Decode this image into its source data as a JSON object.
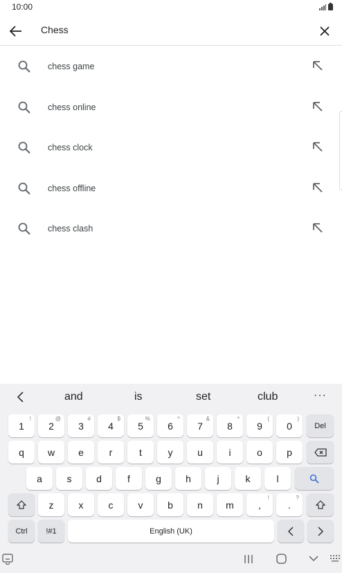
{
  "status_bar": {
    "time": "10:00"
  },
  "search": {
    "query": "Chess"
  },
  "suggestions": [
    {
      "text": "chess game"
    },
    {
      "text": "chess online"
    },
    {
      "text": "chess clock"
    },
    {
      "text": "chess offline"
    },
    {
      "text": "chess clash"
    }
  ],
  "keyboard": {
    "predictions": [
      "and",
      "is",
      "set",
      "club"
    ],
    "more": "···",
    "row1": [
      {
        "k": "1",
        "s": "!"
      },
      {
        "k": "2",
        "s": "@"
      },
      {
        "k": "3",
        "s": "#"
      },
      {
        "k": "4",
        "s": "$"
      },
      {
        "k": "5",
        "s": "%"
      },
      {
        "k": "6",
        "s": "^"
      },
      {
        "k": "7",
        "s": "&"
      },
      {
        "k": "8",
        "s": "*"
      },
      {
        "k": "9",
        "s": "("
      },
      {
        "k": "0",
        "s": ")"
      }
    ],
    "del": "Del",
    "row2": [
      "q",
      "w",
      "e",
      "r",
      "t",
      "y",
      "u",
      "i",
      "o",
      "p"
    ],
    "row3": [
      "a",
      "s",
      "d",
      "f",
      "g",
      "h",
      "j",
      "k",
      "l"
    ],
    "row4": [
      "z",
      "x",
      "c",
      "v",
      "b",
      "n",
      "m"
    ],
    "comma": {
      "k": ",",
      "s": "!"
    },
    "period": {
      "k": ".",
      "s": "?"
    },
    "ctrl": "Ctrl",
    "symbols": "!#1",
    "space": "English (UK)"
  },
  "colors": {
    "accent": "#3c6fd8",
    "keyboard_bg": "#f1f1f4"
  }
}
